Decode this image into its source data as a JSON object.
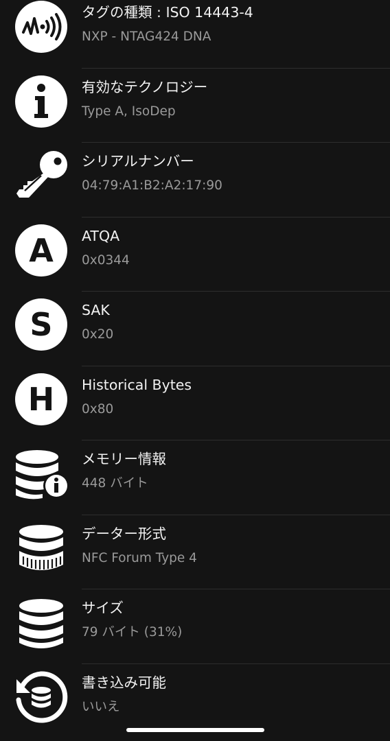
{
  "rows": [
    {
      "title": "タグの種類 : ISO 14443-4",
      "value": "NXP - NTAG424 DNA",
      "icon": "nfc-tag-icon"
    },
    {
      "title": "有効なテクノロジー",
      "value": "Type A, IsoDep",
      "icon": "info-icon"
    },
    {
      "title": "シリアルナンバー",
      "value": "04:79:A1:B2:A2:17:90",
      "icon": "key-icon"
    },
    {
      "title": "ATQA",
      "value": "0x0344",
      "icon": "letter-a-icon"
    },
    {
      "title": "SAK",
      "value": "0x20",
      "icon": "letter-s-icon"
    },
    {
      "title": "Historical Bytes",
      "value": "0x80",
      "icon": "letter-h-icon"
    },
    {
      "title": "メモリー情報",
      "value": "448 バイト",
      "icon": "database-info-icon"
    },
    {
      "title": "データー形式",
      "value": "NFC Forum Type 4",
      "icon": "database-format-icon"
    },
    {
      "title": "サイズ",
      "value": "79 バイト (31%)",
      "icon": "database-icon"
    },
    {
      "title": "書き込み可能",
      "value": "いいえ",
      "icon": "database-restore-icon"
    }
  ],
  "icon_letters": {
    "a": "A",
    "s": "S",
    "h": "H",
    "i": "i"
  },
  "colors": {
    "background": "#141414",
    "title": "#f2f2f2",
    "value": "#9a9a9a",
    "divider": "#2e2e2e",
    "icon": "#ffffff"
  }
}
